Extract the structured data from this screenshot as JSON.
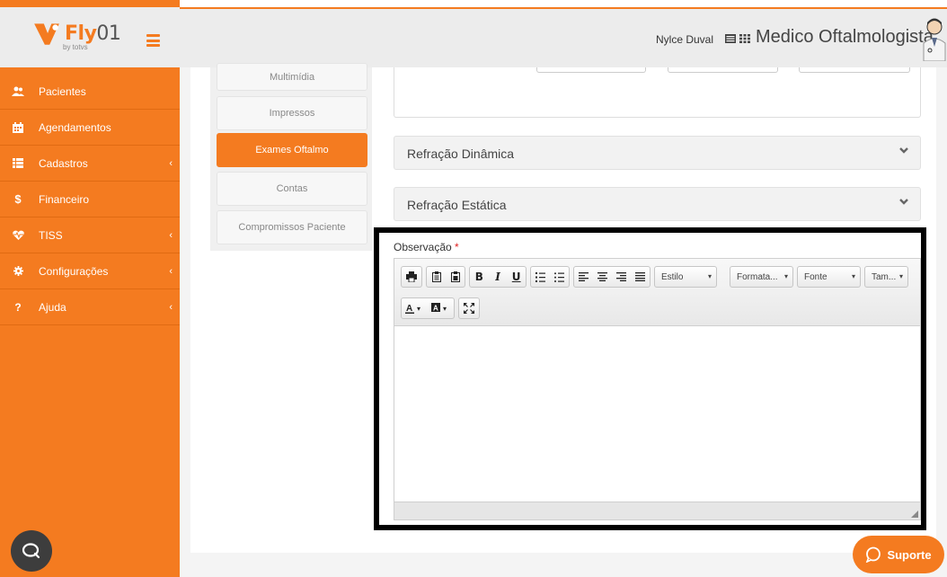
{
  "brand": {
    "name": "Fly",
    "suffix": "01",
    "byline": "by totvs",
    "accent": "#f47b20"
  },
  "sidebar": {
    "items": [
      {
        "label": "Pacientes",
        "icon": "users-icon",
        "has_submenu": false
      },
      {
        "label": "Agendamentos",
        "icon": "calendar-icon",
        "has_submenu": false
      },
      {
        "label": "Cadastros",
        "icon": "list-icon",
        "has_submenu": true
      },
      {
        "label": "Financeiro",
        "icon": "dollar-icon",
        "has_submenu": false
      },
      {
        "label": "TISS",
        "icon": "heartbeat-icon",
        "has_submenu": true
      },
      {
        "label": "Configurações",
        "icon": "gear-icon",
        "has_submenu": true
      },
      {
        "label": "Ajuda",
        "icon": "question-icon",
        "has_submenu": true
      }
    ]
  },
  "header": {
    "user_name": "Nylce Duval",
    "role": "Medico Oftalmologista"
  },
  "tabs": {
    "items": [
      {
        "label": "Multimídia",
        "active": false
      },
      {
        "label": "Impressos",
        "active": false
      },
      {
        "label": "Exames Oftalmo",
        "active": true
      },
      {
        "label": "Contas",
        "active": false
      },
      {
        "label": "Compromissos Paciente",
        "active": false
      }
    ]
  },
  "sections": {
    "refracao_dinamica": "Refração Dinâmica",
    "refracao_estatica": "Refração Estática"
  },
  "editor": {
    "label": "Observação",
    "required_mark": "*",
    "combos": {
      "style": "Estilo",
      "format": "Formata...",
      "font": "Fonte",
      "size": "Tam..."
    },
    "content": ""
  },
  "support": {
    "label": "Suporte"
  }
}
